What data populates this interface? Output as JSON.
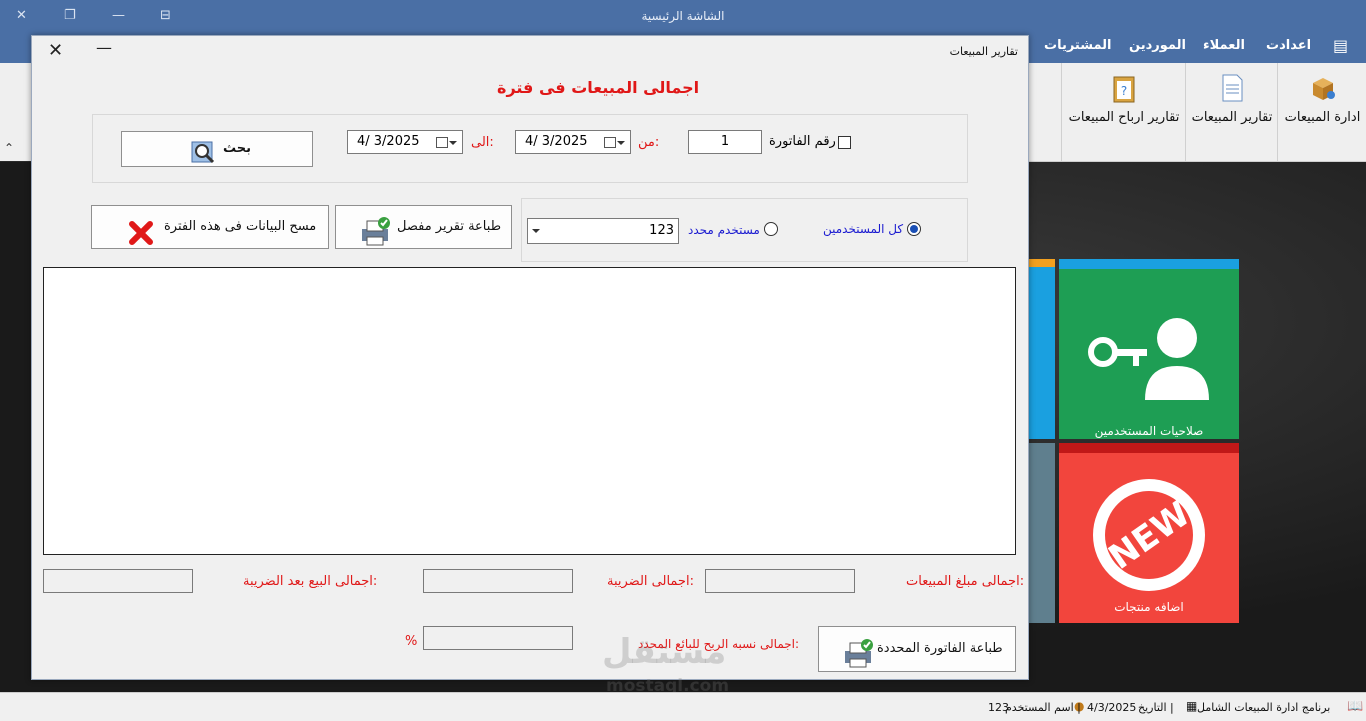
{
  "window": {
    "title": "الشاشة الرئيسية"
  },
  "menu": [
    "اعدادت",
    "العملاء",
    "الموردين",
    "المشتريات"
  ],
  "ribbon": [
    {
      "label": "ادارة المبيعات",
      "icon": "box-icon"
    },
    {
      "label": "تقارير المبيعات",
      "icon": "document-icon"
    },
    {
      "label": "تقارير ارباح المبيعات",
      "icon": "clipboard-icon"
    }
  ],
  "tiles": {
    "permissions": "صلاحيات المستخدمين",
    "add_products": "اضافه منتجات",
    "new_badge": "NEW"
  },
  "dialog": {
    "caption": "تقارير المبيعات",
    "heading": "اجمالى المبيعات فى فترة",
    "invoice_label": "رقم الفاتورة",
    "invoice_value": "1",
    "from_label": "من:",
    "from_date": "4/  3/2025",
    "to_label": "الى:",
    "to_date": "4/  3/2025",
    "search_button": "بحث",
    "all_users_label": "كل المستخدمين",
    "specific_user_label": "مستخدم محدد",
    "user_value": "123",
    "print_detail_button": "طباعة تقرير مفصل",
    "clear_button": "مسح البيانات فى هذه الفترة",
    "total_sales_label": "اجمالى مبلغ المبيعات:",
    "total_tax_label": "اجمالى الضريبة:",
    "total_after_tax_label": "اجمالى البيع بعد الضريبة:",
    "profit_label": "اجمالى نسبه الربح للبائع المحدد:",
    "percent_sign": "%",
    "print_invoice_button": "طباعة الفاتورة المحددة"
  },
  "status": {
    "app_name": "برنامج ادارة المبيعات الشامل",
    "date_label": "التاريخ |",
    "date_value": "4/3/2025",
    "user_label": "اسم المستخدم |",
    "user_value": "123"
  },
  "watermark": {
    "brand": "مستقل",
    "url": "mostaql.com"
  },
  "colors": {
    "titlebar": "#4a6fa5",
    "tile_green": "#1e9e54",
    "tile_red": "#f2453d",
    "tile_blue": "#1aa0e0",
    "accent_red": "#e01818"
  }
}
